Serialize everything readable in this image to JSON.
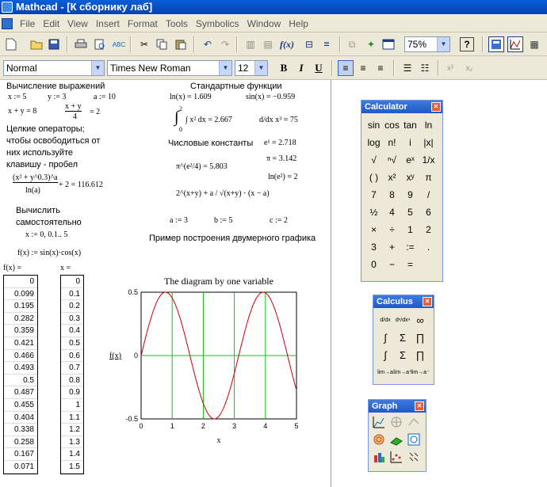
{
  "window": {
    "title": "Mathcad - [К сборнику лаб]"
  },
  "menu": [
    "File",
    "Edit",
    "View",
    "Insert",
    "Format",
    "Tools",
    "Symbolics",
    "Window",
    "Help"
  ],
  "toolbar": {
    "zoom": "75%",
    "help_label": "?"
  },
  "format_toolbar": {
    "style": "Normal",
    "font": "Times New Roman",
    "size": "12",
    "bold": "B",
    "italic": "I",
    "underline": "U",
    "super": "x²",
    "sub": "x₂"
  },
  "worksheet": {
    "title_calc": "Вычисление выражений",
    "assign_x": "x := 5",
    "assign_y": "y := 3",
    "assign_a": "a := 10",
    "sum_eq": "x + y = 8",
    "frac_num": "x + y",
    "frac_den": "4",
    "frac_res": "= 2",
    "note1": "Целкие операторы;",
    "note2": "чтобы освободиться от",
    "note3": "них используйте",
    "note4": "клавишу - пробел",
    "big_num": "(x² + y^0.3)^a",
    "big_den": "ln(a)",
    "big_res": "+ 2 = 116.612",
    "task1": "Вычислить",
    "task2": "самостоятельно",
    "range": "x := 0, 0.1.. 5",
    "func": "f(x) := sin(x)·cos(x)",
    "std_title": "Стандартные функции",
    "ln_eq": "ln(x) = 1.609",
    "sin_eq": "sin(x) = −0.959",
    "integral": "∫ x² dx = 2.667",
    "int_hi": "2",
    "int_lo": "0",
    "deriv": "d/dx x³ = 75",
    "const_title": "Числовые константы",
    "e1": "e¹ = 2.718",
    "pi_eq": "π = 3.142",
    "pi_e": "π^(e²/4) = 5.803",
    "ln_e2": "ln(e²) = 2",
    "sym_expr": "2^(x+y) + a / √(x+y) · (x − a)",
    "a3": "a := 3",
    "b5": "b := 5",
    "c2": "c := 2",
    "graph_title": "Пример построения двумерного графика",
    "fx_header": "f(x) =",
    "x_header": "x ="
  },
  "fx_values": [
    "0",
    "0.099",
    "0.195",
    "0.282",
    "0.359",
    "0.421",
    "0.466",
    "0.493",
    "0.5",
    "0.487",
    "0.455",
    "0.404",
    "0.338",
    "0.258",
    "0.167",
    "0.071"
  ],
  "x_values": [
    "0",
    "0.1",
    "0.2",
    "0.3",
    "0.4",
    "0.5",
    "0.6",
    "0.7",
    "0.8",
    "0.9",
    "1",
    "1.1",
    "1.2",
    "1.3",
    "1.4",
    "1.5"
  ],
  "chart_data": {
    "type": "line",
    "title": "The diagram by one variable",
    "xlabel": "x",
    "ylabel": "f(x)",
    "xlim": [
      0,
      5
    ],
    "ylim": [
      -0.5,
      0.5
    ],
    "xticks": [
      "0",
      "1",
      "2",
      "3",
      "4",
      "5"
    ],
    "yticks": [
      "0.5",
      "0",
      "-0.5"
    ],
    "function": "sin(x)·cos(x)",
    "series": [
      {
        "color": "#cc0000"
      }
    ]
  },
  "calculator": {
    "title": "Calculator",
    "keys": [
      "sin",
      "cos",
      "tan",
      "ln",
      "log",
      "n!",
      "i",
      "|x|",
      "√",
      "ⁿ√",
      "eˣ",
      "1/x",
      "( )",
      "x²",
      "xʸ",
      "π",
      "7",
      "8",
      "9",
      "/",
      "÷",
      "4",
      "5",
      "6",
      "×",
      "÷",
      "1",
      "2",
      "3",
      "+",
      ":=",
      ".",
      "0",
      "−",
      "="
    ]
  },
  "calculus": {
    "title": "Calculus"
  },
  "graph": {
    "title": "Graph"
  }
}
